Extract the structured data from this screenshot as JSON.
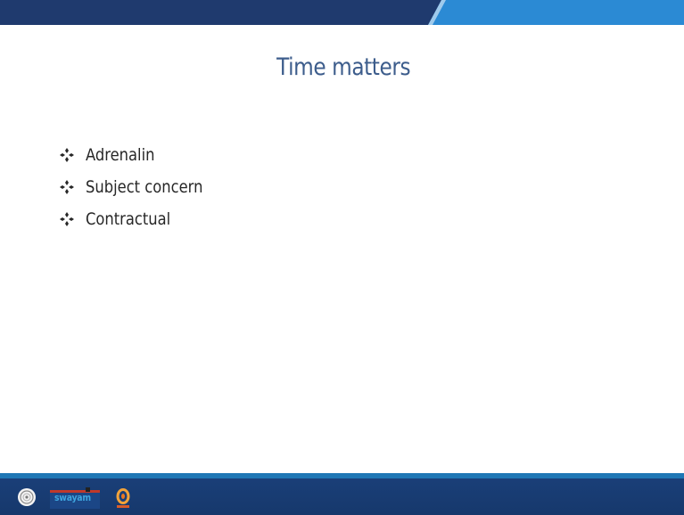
{
  "slide": {
    "title": "Time matters",
    "bullets": [
      "Adrenalin",
      "Subject concern",
      "Contractual"
    ]
  },
  "footer": {
    "logos": [
      {
        "icon": "nptel-logo-icon"
      },
      {
        "icon": "swayam-logo-icon",
        "text": "swayam"
      },
      {
        "icon": "institute-logo-icon"
      }
    ]
  },
  "colors": {
    "title": "#3d5d8c",
    "body_text": "#262626",
    "top_band_dark": "#1f3a6e",
    "top_band_light": "#2b8ad4",
    "bottom_rule": "#1f77b5",
    "bottom_bar": "#1a3f78"
  }
}
